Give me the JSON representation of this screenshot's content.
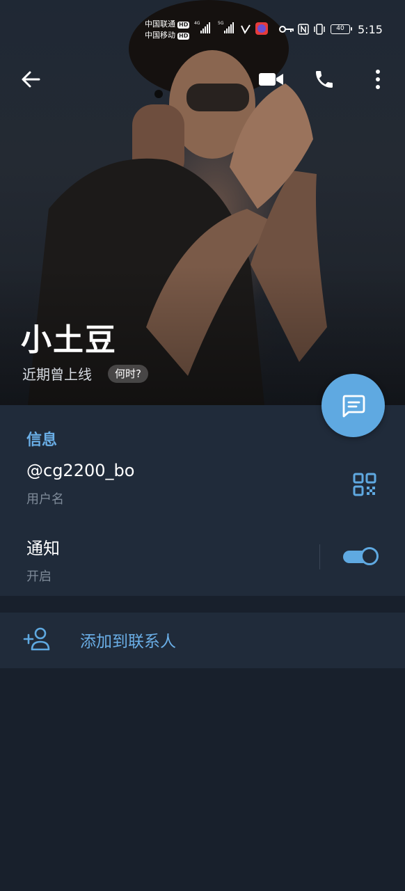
{
  "status_bar": {
    "carrier1": "中国联通",
    "carrier2": "中国移动",
    "hd": "HD",
    "net1": "4G",
    "net2": "5G",
    "battery": "40",
    "time": "5:15"
  },
  "header": {
    "back_icon": "arrow-left-icon",
    "video_icon": "video-camera-icon",
    "call_icon": "phone-icon",
    "menu_icon": "more-vertical-icon"
  },
  "profile": {
    "name": "小土豆",
    "status": "近期曾上线",
    "when_label": "何时?"
  },
  "fab": {
    "icon": "chat-message-icon"
  },
  "info": {
    "section_title": "信息",
    "username": "@cg2200_bo",
    "username_caption": "用户名",
    "qr_icon": "qr-code-icon",
    "notifications_label": "通知",
    "notifications_value": "开启",
    "notifications_on": true
  },
  "actions": {
    "add_contact_icon": "add-user-icon",
    "add_contact_label": "添加到联系人"
  },
  "colors": {
    "accent": "#5fa9e1",
    "background": "#18202c",
    "panel": "#202b3a"
  }
}
